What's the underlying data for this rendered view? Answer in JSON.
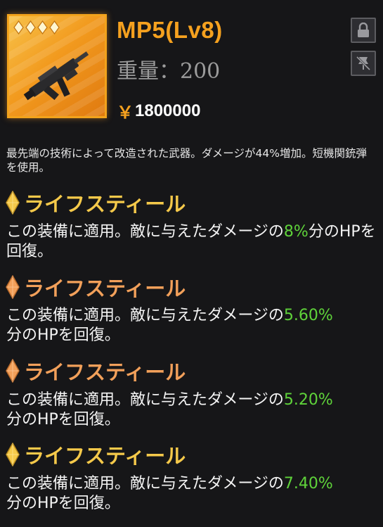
{
  "item": {
    "name": "MP5(Lv8)",
    "weight_label": "重量：200",
    "price_symbol": "￥",
    "price": "1800000",
    "rarity_stars": 4
  },
  "buttons": {
    "lock_icon": "lock-icon",
    "unpin_icon": "unpin-icon"
  },
  "description": "最先端の技術によって改造された武器。ダメージが44%増加。短機関銃弾を使用。",
  "skills": [
    {
      "title": "ライフスティール",
      "color": "#f5c94a",
      "desc_a": "この装備に適用。敵に与えたダメージの",
      "percent": "8%",
      "desc_b": "分のHPを回復。"
    },
    {
      "title": "ライフスティール",
      "color": "#f2a05a",
      "desc_a": "この装備に適用。敵に与えたダメージの",
      "percent": "5.60%",
      "desc_b": "分のHPを回復。"
    },
    {
      "title": "ライフスティール",
      "color": "#f2a05a",
      "desc_a": "この装備に適用。敵に与えたダメージの",
      "percent": "5.20%",
      "desc_b": "分のHPを回復。"
    },
    {
      "title": "ライフスティール",
      "color": "#f5c94a",
      "desc_a": "この装備に適用。敵に与えたダメージの",
      "percent": "7.40%",
      "desc_b": "分のHPを回復。"
    }
  ],
  "colors": {
    "accent": "#f5a11f",
    "percent_green": "#5fd33a",
    "gold_title": "#f5c94a",
    "orange_title": "#f2a05a"
  }
}
